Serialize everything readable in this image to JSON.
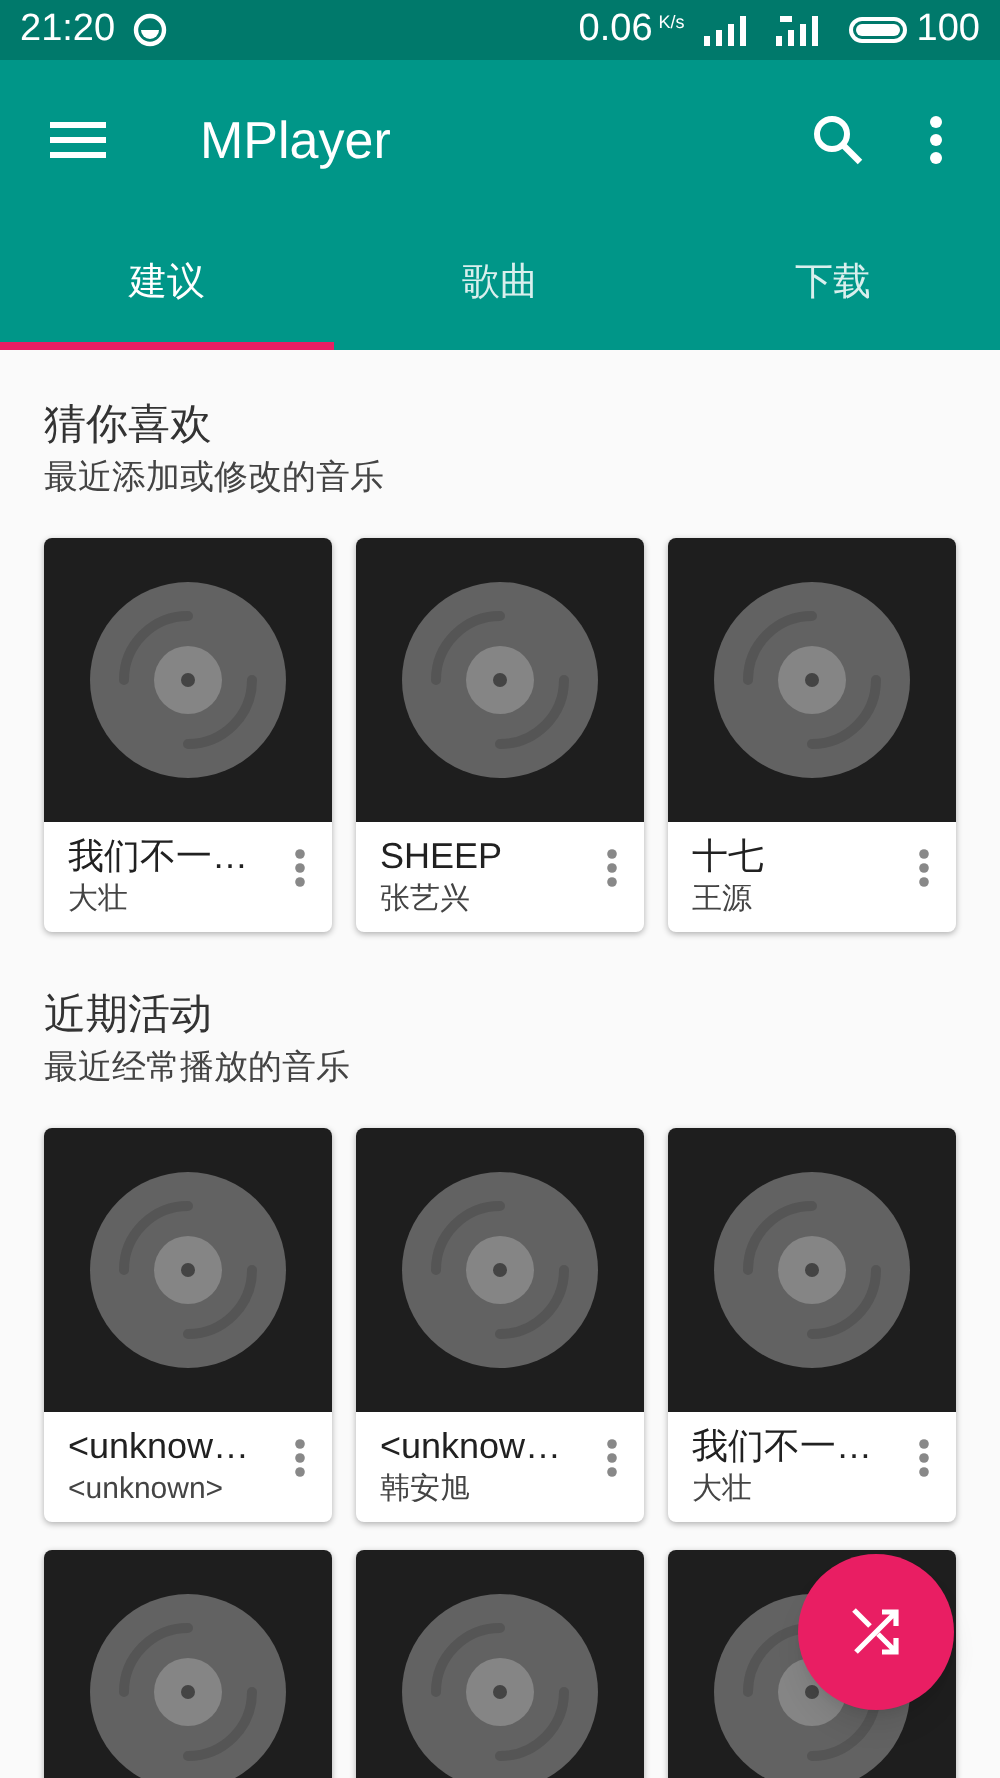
{
  "status_bar": {
    "time": "21:20",
    "speed": "0.06",
    "speed_unit": "K/s",
    "battery": "100"
  },
  "app_bar": {
    "title": "MPlayer"
  },
  "tabs": [
    {
      "label": "建议",
      "selected": true
    },
    {
      "label": "歌曲",
      "selected": false
    },
    {
      "label": "下载",
      "selected": false
    }
  ],
  "sections": [
    {
      "title": "猜你喜欢",
      "subtitle": "最近添加或修改的音乐",
      "albums": [
        {
          "kind": "titled",
          "title": "我们不一…",
          "artist": "大壮"
        },
        {
          "kind": "titled",
          "title": "SHEEP",
          "artist": "张艺兴"
        },
        {
          "kind": "titled",
          "title": "十七",
          "artist": "王源"
        }
      ]
    },
    {
      "title": "近期活动",
      "subtitle": "最近经常播放的音乐",
      "albums": [
        {
          "kind": "titled",
          "title": "<unknow…",
          "artist": "<unknown>"
        },
        {
          "kind": "titled",
          "title": "<unknow…",
          "artist": "韩安旭"
        },
        {
          "kind": "titled",
          "title": "我们不一…",
          "artist": "大壮"
        },
        {
          "kind": "art_only"
        },
        {
          "kind": "art_only"
        },
        {
          "kind": "art_only"
        }
      ]
    }
  ]
}
